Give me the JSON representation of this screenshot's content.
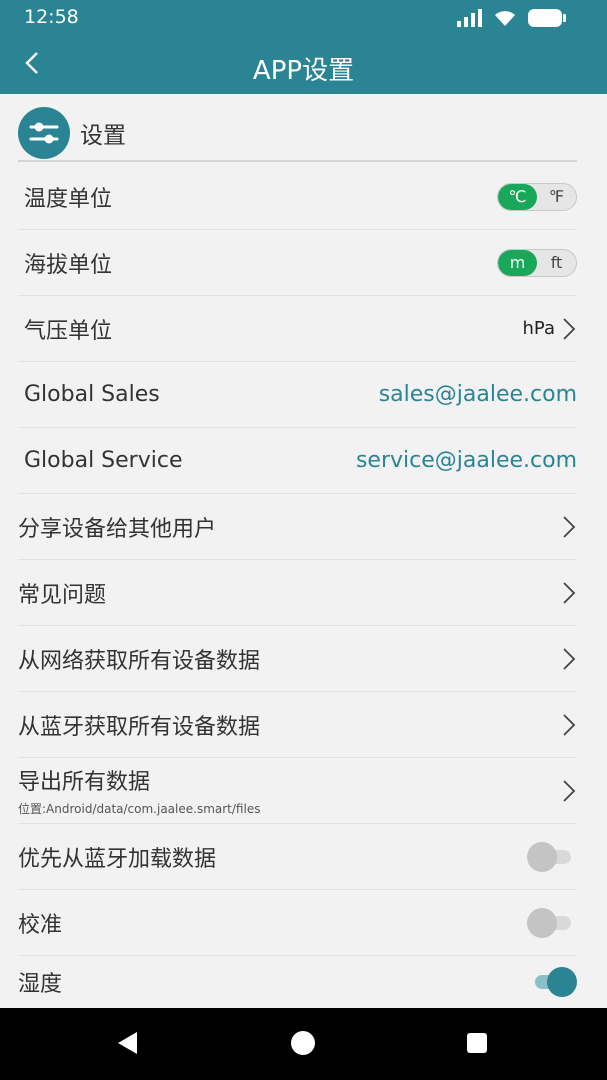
{
  "status": {
    "time": "12:58"
  },
  "header": {
    "title": "APP设置"
  },
  "section": {
    "title": "设置"
  },
  "rows": {
    "temp": {
      "label": "温度单位",
      "options": [
        "℃",
        "℉"
      ],
      "selected": "℃"
    },
    "altitude": {
      "label": "海拔单位",
      "options": [
        "m",
        "ft"
      ],
      "selected": "m"
    },
    "pressure": {
      "label": "气压单位",
      "value": "hPa"
    },
    "sales": {
      "label": "Global Sales",
      "value": "sales@jaalee.com"
    },
    "service": {
      "label": "Global Service",
      "value": "service@jaalee.com"
    },
    "share": {
      "label": "分享设备给其他用户"
    },
    "faq": {
      "label": "常见问题"
    },
    "fetch_net": {
      "label": "从网络获取所有设备数据"
    },
    "fetch_bt": {
      "label": "从蓝牙获取所有设备数据"
    },
    "export": {
      "label": "导出所有数据",
      "sub": "位置:Android/data/com.jaalee.smart/files"
    },
    "prefer_bt": {
      "label": "优先从蓝牙加载数据",
      "on": false
    },
    "calibrate": {
      "label": "校准",
      "on": false
    },
    "humidity": {
      "label": "湿度",
      "on": true
    }
  },
  "colors": {
    "primary": "#2a8494",
    "green": "#19a85a",
    "link": "#2a8494"
  },
  "icons": [
    "back-arrow-icon",
    "signal-icon",
    "wifi-icon",
    "battery-icon",
    "settings-sliders-icon",
    "chevron-right-icon",
    "nav-back-icon",
    "nav-home-icon",
    "nav-recents-icon"
  ]
}
